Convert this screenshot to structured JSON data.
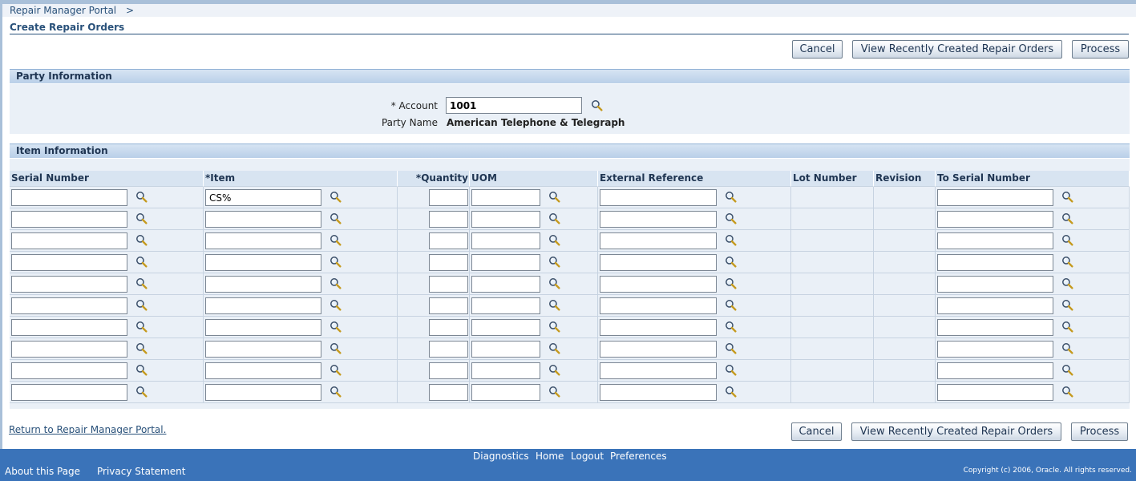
{
  "breadcrumb": {
    "portal_label": "Repair Manager Portal",
    "separator": ">"
  },
  "page_title": "Create Repair Orders",
  "buttons": {
    "cancel": "Cancel",
    "view_recent": "View Recently Created Repair Orders",
    "process": "Process"
  },
  "party_section": {
    "title": "Party Information",
    "account_label": "* Account",
    "account_value": "1001",
    "party_name_label": "Party Name",
    "party_name_value": "American Telephone & Telegraph"
  },
  "item_section": {
    "title": "Item Information",
    "columns": {
      "serial_number": "Serial Number",
      "item": "*Item",
      "quantity": "*Quantity",
      "uom": "UOM",
      "external_reference": "External Reference",
      "lot_number": "Lot Number",
      "revision": "Revision",
      "to_serial_number": "To Serial Number"
    },
    "rows": [
      {
        "serial_number": "",
        "item": "CS%",
        "quantity": "",
        "uom": "",
        "external_reference": "",
        "to_serial_number": ""
      },
      {
        "serial_number": "",
        "item": "",
        "quantity": "",
        "uom": "",
        "external_reference": "",
        "to_serial_number": ""
      },
      {
        "serial_number": "",
        "item": "",
        "quantity": "",
        "uom": "",
        "external_reference": "",
        "to_serial_number": ""
      },
      {
        "serial_number": "",
        "item": "",
        "quantity": "",
        "uom": "",
        "external_reference": "",
        "to_serial_number": ""
      },
      {
        "serial_number": "",
        "item": "",
        "quantity": "",
        "uom": "",
        "external_reference": "",
        "to_serial_number": ""
      },
      {
        "serial_number": "",
        "item": "",
        "quantity": "",
        "uom": "",
        "external_reference": "",
        "to_serial_number": ""
      },
      {
        "serial_number": "",
        "item": "",
        "quantity": "",
        "uom": "",
        "external_reference": "",
        "to_serial_number": ""
      },
      {
        "serial_number": "",
        "item": "",
        "quantity": "",
        "uom": "",
        "external_reference": "",
        "to_serial_number": ""
      },
      {
        "serial_number": "",
        "item": "",
        "quantity": "",
        "uom": "",
        "external_reference": "",
        "to_serial_number": ""
      },
      {
        "serial_number": "",
        "item": "",
        "quantity": "",
        "uom": "",
        "external_reference": "",
        "to_serial_number": ""
      }
    ]
  },
  "return_link": "Return to Repair Manager Portal.",
  "footer": {
    "links": [
      "Diagnostics",
      "Home",
      "Logout",
      "Preferences"
    ],
    "about": "About this Page",
    "privacy": "Privacy Statement",
    "copyright": "Copyright (c) 2006, Oracle. All rights reserved."
  },
  "icons": {
    "lookup": "magnifier-lookup-icon"
  },
  "colors": {
    "brand_blue": "#3a73b9",
    "link_blue": "#29517a",
    "panel_bg": "#eaf0f7",
    "header_bg": "#d8e4f1"
  }
}
